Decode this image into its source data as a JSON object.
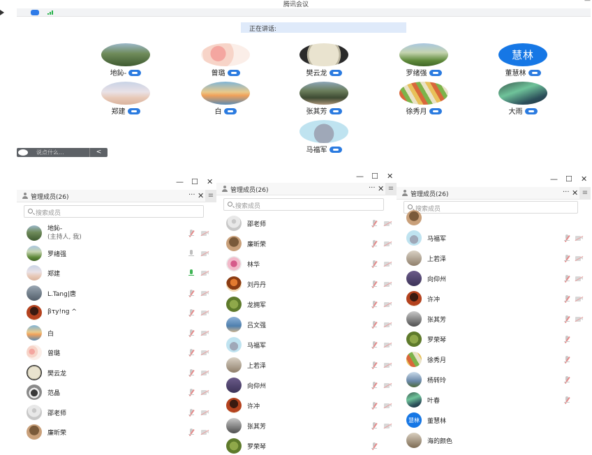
{
  "window": {
    "title": "腾讯会议"
  },
  "speaking_label": "正在讲话:",
  "tiles": [
    {
      "name": "地鈊-",
      "avatar": "a-mtn"
    },
    {
      "name": "曾璐",
      "avatar": "a-flowers"
    },
    {
      "name": "樊云龙",
      "avatar": "a-moon"
    },
    {
      "name": "罗绪强",
      "avatar": "a-hill"
    },
    {
      "name": "董慧林",
      "avatar": "text",
      "avatar_text": "慧林"
    },
    {
      "name": "郑建",
      "avatar": "a-beach"
    },
    {
      "name": "白",
      "avatar": "a-sunset"
    },
    {
      "name": "张其芳",
      "avatar": "a-trees"
    },
    {
      "name": "徐秀月",
      "avatar": "a-pens"
    },
    {
      "name": "大雨",
      "avatar": "a-aurora"
    },
    {
      "name": "马福军",
      "avatar": "a-bunny"
    }
  ],
  "chat": {
    "placeholder": "说点什么...",
    "send": "<"
  },
  "panels": [
    {
      "title": "管理成员(26)",
      "more": "···",
      "close": "✕",
      "menu": "≡",
      "window_controls": {
        "min": "—",
        "max": "☐",
        "close": "✕"
      },
      "search_placeholder": "搜索成员",
      "members": [
        {
          "name": "地鈊-",
          "sub": "(主持人, 我)",
          "avatar": "a-mtn",
          "mic": "off",
          "cam": true
        },
        {
          "name": "罗绪强",
          "avatar": "a-hill",
          "mic": "idle",
          "cam": true
        },
        {
          "name": "郑建",
          "avatar": "a-beach",
          "mic": "on",
          "cam": true
        },
        {
          "name": "L.Tang|唐",
          "avatar": "a-tang",
          "mic": "off",
          "cam": true
        },
        {
          "name": "βτy!ng ^",
          "avatar": "a-redwoman",
          "mic": "off",
          "cam": true
        },
        {
          "name": "白",
          "avatar": "a-sunset",
          "mic": "off",
          "cam": true
        },
        {
          "name": "曾璐",
          "avatar": "a-flowers",
          "mic": "off",
          "cam": true
        },
        {
          "name": "樊云龙",
          "avatar": "a-moon",
          "mic": "off",
          "cam": true
        },
        {
          "name": "范晶",
          "avatar": "a-dog",
          "mic": "off",
          "cam": true
        },
        {
          "name": "邵老师",
          "avatar": "a-gray",
          "mic": "off",
          "cam": true
        },
        {
          "name": "廉昕荣",
          "avatar": "a-brown",
          "mic": "off",
          "cam": true
        }
      ]
    },
    {
      "title": "管理成员(26)",
      "more": "···",
      "close": "✕",
      "menu": "≡",
      "window_controls": {
        "min": "—",
        "max": "☐",
        "close": "✕"
      },
      "search_placeholder": "搜索成员",
      "members": [
        {
          "name": "邵老师",
          "avatar": "a-gray",
          "mic": "off",
          "cam": true
        },
        {
          "name": "廉昕荣",
          "avatar": "a-brown",
          "mic": "off",
          "cam": true
        },
        {
          "name": "林华",
          "avatar": "a-flower2",
          "mic": "off",
          "cam": true
        },
        {
          "name": "刘丹丹",
          "avatar": "a-girl",
          "mic": "off",
          "cam": true
        },
        {
          "name": "龙拥军",
          "avatar": "a-grass",
          "mic": "off",
          "cam": true
        },
        {
          "name": "吕文强",
          "avatar": "a-sea",
          "mic": "off",
          "cam": true
        },
        {
          "name": "马福军",
          "avatar": "a-bunny",
          "mic": "off",
          "cam": true
        },
        {
          "name": "上若泽",
          "avatar": "a-teacher",
          "mic": "off",
          "cam": true
        },
        {
          "name": "向仰州",
          "avatar": "a-purple",
          "mic": "off",
          "cam": true
        },
        {
          "name": "许冲",
          "avatar": "a-redwoman",
          "mic": "off",
          "cam": true
        },
        {
          "name": "张其芳",
          "avatar": "a-bw",
          "mic": "off",
          "cam": true
        },
        {
          "name": "罗荣琴",
          "avatar": "a-grass",
          "mic": "off",
          "cam": false
        }
      ]
    },
    {
      "title": "管理成员(26)",
      "more": "···",
      "close": "✕",
      "menu": "≡",
      "window_controls": {
        "min": "—",
        "max": "☐",
        "close": "✕"
      },
      "search_placeholder": "搜索成员",
      "members": [
        {
          "name": "",
          "avatar": "a-brown",
          "mic": "none",
          "cam": false
        },
        {
          "name": "马福军",
          "avatar": "a-bunny",
          "mic": "off",
          "cam": true
        },
        {
          "name": "上若泽",
          "avatar": "a-teacher",
          "mic": "off",
          "cam": true
        },
        {
          "name": "向仰州",
          "avatar": "a-purple",
          "mic": "off",
          "cam": true
        },
        {
          "name": "许冲",
          "avatar": "a-redwoman",
          "mic": "off",
          "cam": true
        },
        {
          "name": "张其芳",
          "avatar": "a-bw",
          "mic": "off",
          "cam": true
        },
        {
          "name": "罗荣琴",
          "avatar": "a-grass",
          "mic": "off",
          "cam": false
        },
        {
          "name": "徐秀月",
          "avatar": "a-pens",
          "mic": "off",
          "cam": false
        },
        {
          "name": "杨转玲",
          "avatar": "a-river",
          "mic": "off",
          "cam": false
        },
        {
          "name": "叶春",
          "avatar": "a-aurora",
          "mic": "off",
          "cam": false
        },
        {
          "name": "董慧林",
          "avatar": "text",
          "avatar_text": "慧林",
          "mic": "none",
          "cam": false
        },
        {
          "name": "海的颜色",
          "avatar": "a-stone",
          "mic": "none",
          "cam": false
        }
      ]
    }
  ]
}
